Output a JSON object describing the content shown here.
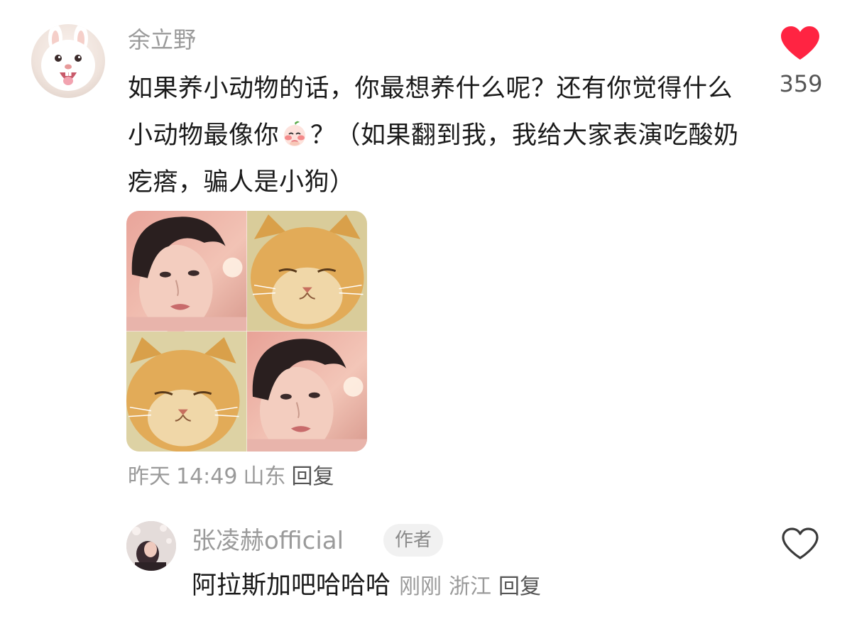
{
  "comment": {
    "username": "余立野",
    "text_part1": "如果养小动物的话，你最想养什么呢？还有你觉得什么小动物最像你",
    "text_part2": "？（如果翻到我，我给大家表演吃酸奶疙瘩，骗人是小狗）",
    "inline_emoji_icon": "shy-peach-emoji",
    "avatar_icon": "white-rabbit-avatar",
    "like_icon": "heart-filled-icon",
    "like_count": "359",
    "like_color": "#ff2442",
    "images": [
      {
        "icon": "young-man-photo"
      },
      {
        "icon": "orange-cat-photo"
      },
      {
        "icon": "orange-cat-photo"
      },
      {
        "icon": "young-man-photo"
      }
    ],
    "meta": {
      "date": "昨天",
      "time": "14:49",
      "location": "山东",
      "reply_label": "回复"
    }
  },
  "reply": {
    "avatar_icon": "author-avatar",
    "username": "张凌赫official",
    "badge": "作者",
    "text": "阿拉斯加吧哈哈哈",
    "time": "刚刚",
    "location": "浙江",
    "reply_label": "回复",
    "like_icon": "heart-outline-icon"
  }
}
